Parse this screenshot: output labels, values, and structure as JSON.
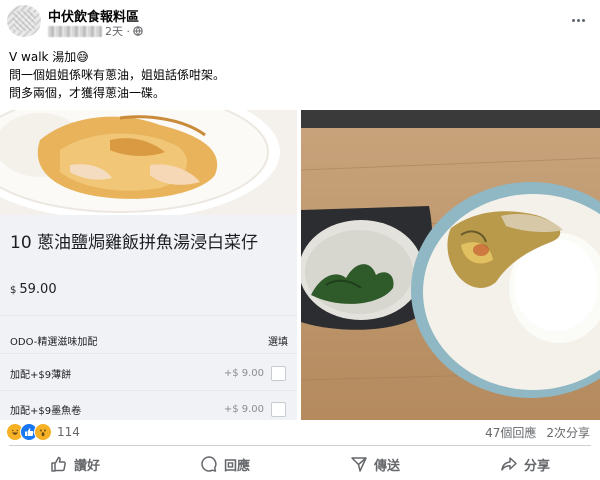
{
  "header": {
    "group_name": "中伏飲食報料區",
    "time": "2天 · ",
    "privacy_icon": "globe-icon",
    "more_icon": "more-dots-icon"
  },
  "post_text": {
    "line1": "V walk 湯加😅",
    "line2": "問一個姐姐係咪有蔥油，姐姐話係咁架。",
    "line3": "問多兩個，才獲得蔥油一碟。"
  },
  "menu_card": {
    "dish_title": "10 蔥油鹽焗雞飯拼魚湯浸白菜仔",
    "currency": "$",
    "price": "59.00",
    "section_label": "ODO-精選滋味加配",
    "section_right": "選填",
    "options": [
      {
        "label": "加配+$9薄餅",
        "price": "+$ 9.00"
      },
      {
        "label": "加配+$9墨魚卷",
        "price": "+$ 9.00"
      }
    ]
  },
  "stats": {
    "reaction_icons": [
      "haha-icon",
      "like-icon",
      "wow-icon"
    ],
    "reaction_count": "114",
    "comments": "47個回應",
    "shares": "2次分享"
  },
  "actions": {
    "like": "讚好",
    "comment": "回應",
    "send": "傳送",
    "share": "分享"
  },
  "colors": {
    "brand_blue": "#1877f2",
    "secondary_text": "#65676b",
    "divider": "#ced0d4"
  }
}
